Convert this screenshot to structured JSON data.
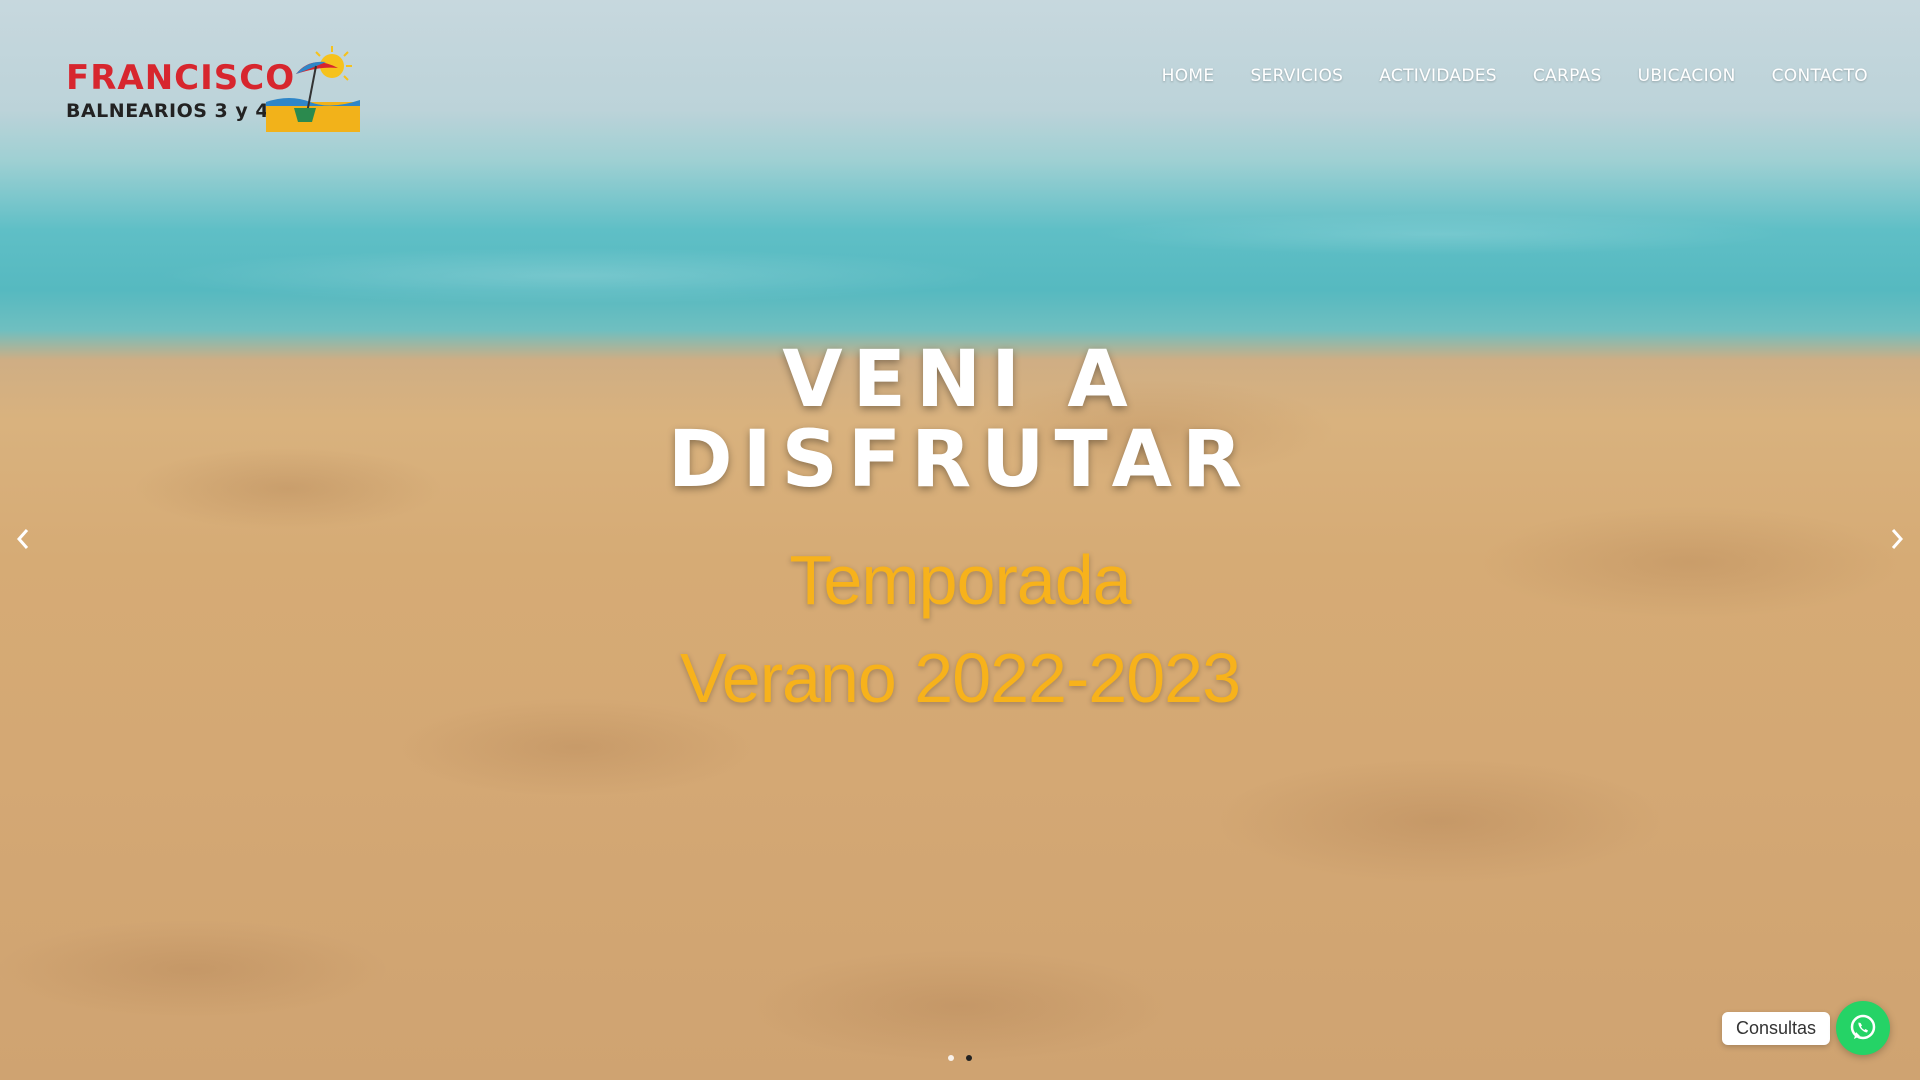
{
  "header": {
    "logo": {
      "title": "FRANCISCO",
      "subtitle": "BALNEARIOS 3 y 4"
    },
    "nav": [
      "HOME",
      "SERVICIOS",
      "ACTIVIDADES",
      "CARPAS",
      "UBICACION",
      "CONTACTO"
    ]
  },
  "hero": {
    "headline_line1": "VENI A",
    "headline_line2": "DISFRUTAR",
    "subline1": "Temporada",
    "subline2": "Verano 2022-2023",
    "prev_icon": "chevron-left-icon",
    "next_icon": "chevron-right-icon",
    "slides": {
      "count": 2,
      "active_index": 1
    }
  },
  "whatsapp": {
    "label": "Consultas",
    "icon": "whatsapp-icon"
  },
  "colors": {
    "logo_red": "#d7262e",
    "headline_white": "#ffffff",
    "subline_yellow": "#f7b21b",
    "whatsapp_green": "#25d366"
  }
}
